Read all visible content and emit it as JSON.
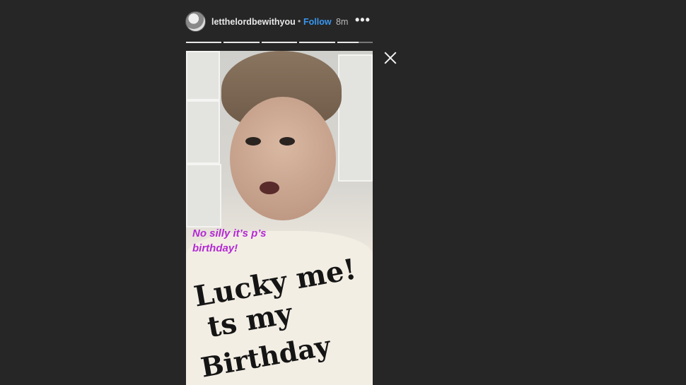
{
  "header": {
    "username": "letthelordbewithyou",
    "separator": "•",
    "follow_label": "Follow",
    "time": "8m",
    "more_icon": "•••"
  },
  "progress": {
    "segments": 5,
    "current_segment": 5,
    "current_fill": 0.6
  },
  "story": {
    "caption_line1": "No silly it’s p’s",
    "caption_line2": "birthday!",
    "caption_color": "#b429d4",
    "shirt_lines": [
      "Lucky me!",
      "ts my",
      "Birthday"
    ]
  },
  "colors": {
    "background": "#262626",
    "accent": "#3897f0"
  }
}
